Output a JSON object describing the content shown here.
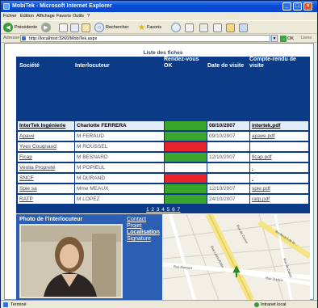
{
  "window": {
    "title": "MobiTek - Microsoft Internet Explorer",
    "min": "_",
    "max": "□",
    "close": "×"
  },
  "menu": [
    "Fichier",
    "Édition",
    "Affichage",
    "Favoris",
    "Outils",
    "?"
  ],
  "toolbar": {
    "back": "Précédente",
    "search": "Rechercher",
    "favorites": "Favoris"
  },
  "address": {
    "label": "Adresse",
    "url": "http://localhost:3260/MobiTek.aspx",
    "go": "OK",
    "links": "Liens"
  },
  "grid": {
    "caption": "Liste des fiches",
    "headers": {
      "societe": "Société",
      "interlocuteur": "Interlocuteur",
      "rdv": "Rendez-vous OK",
      "date": "Date de visite",
      "compte": "Compte-rendu de visite"
    },
    "rows": [
      {
        "societe": "InterTek Ingénierie",
        "interlocuteur": "Charlotte FERRERA",
        "status": "ok",
        "date": "08/10/2007",
        "compte": "intertek.pdf"
      },
      {
        "societe": "Apave",
        "interlocuteur": "M FERAUD",
        "status": "ok",
        "date": "09/10/2007",
        "compte": "apave.pdf"
      },
      {
        "societe": "Yves Cougnaud",
        "interlocuteur": "M ROUSSEL",
        "status": "ko",
        "date": "",
        "compte": ""
      },
      {
        "societe": "Ficap",
        "interlocuteur": "M BESNARD",
        "status": "ok",
        "date": "12/10/2007",
        "compte": "ficap.pdf"
      },
      {
        "societe": "Veolia Propreté",
        "interlocuteur": "M POPIEUL",
        "status": "none",
        "date": "",
        "compte": "."
      },
      {
        "societe": "SNCF",
        "interlocuteur": "M DURAND",
        "status": "ko",
        "date": "",
        "compte": "."
      },
      {
        "societe": "Spie sa",
        "interlocuteur": "Mme MEAUX",
        "status": "ok",
        "date": "12/10/2007",
        "compte": "spie.pdf"
      },
      {
        "societe": "RATP",
        "interlocuteur": "M LOPEZ",
        "status": "ok",
        "date": "24/10/2007",
        "compte": "ratp.pdf"
      }
    ],
    "pager": "1 2 3 4 5 6 7"
  },
  "detail": {
    "photo_title": "Photo de l'interlocuteur",
    "links": [
      {
        "label": "Contact",
        "active": false
      },
      {
        "label": "Projet",
        "active": false
      },
      {
        "label": "Localisation",
        "active": true
      },
      {
        "label": "Signature",
        "active": false
      }
    ]
  },
  "map": {
    "streets": [
      "Rue Ledru-Rollin",
      "Boulevard de la ...",
      "Rue de Cuvier",
      "Rue Mansart",
      "Rue Dupleix",
      "Rue de Calais"
    ]
  },
  "status": {
    "left": "Terminé",
    "right": "Intranet local"
  },
  "colors": {
    "accent": "#0b3b86",
    "ok": "#3aa62d",
    "ko": "#e8232b"
  }
}
